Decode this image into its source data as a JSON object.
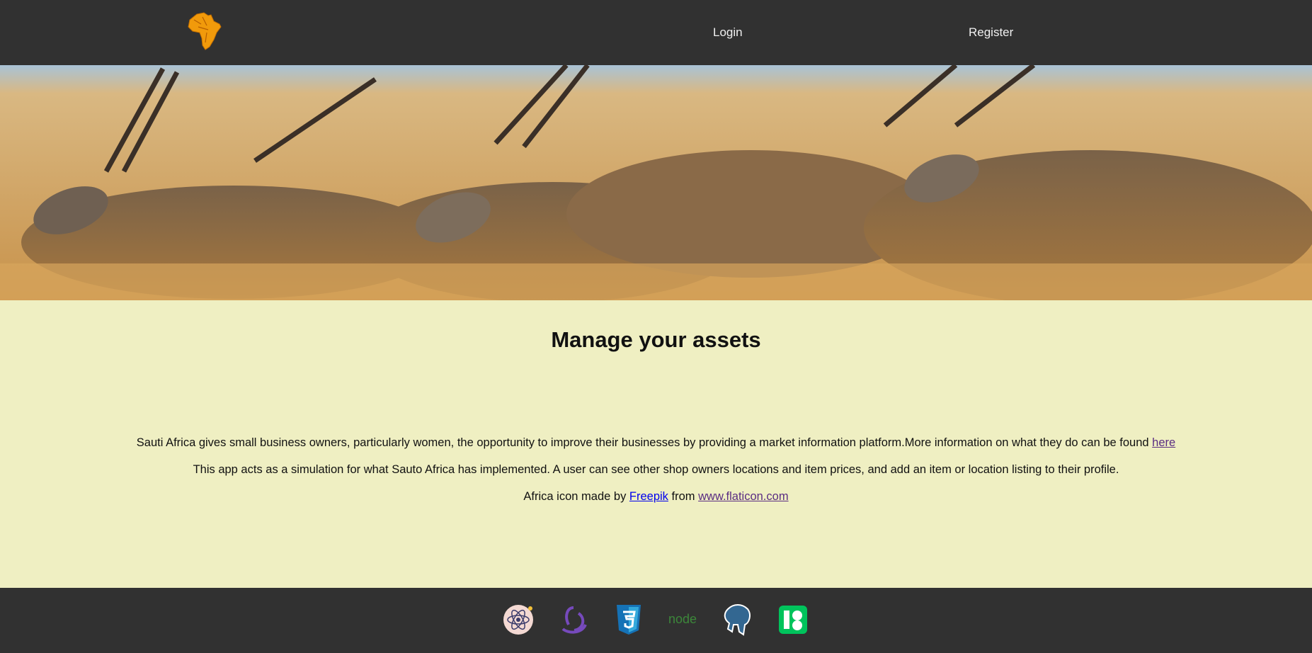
{
  "nav": {
    "login_label": "Login",
    "register_label": "Register",
    "logo_icon": "africa-icon"
  },
  "hero": {
    "image": "eland-antelopes-grassland-photo"
  },
  "main": {
    "heading": "Manage your assets",
    "intro_text": "Sauti Africa gives small business owners, particularly women, the opportunity to improve their businesses by providing a market information platform.More information on what they do can be found ",
    "intro_link": "here",
    "sim_text": "This app acts as a simulation for what Sauto Africa has implemented. A user can see other shop owners locations and item prices, and add an item or location listing to their profile.",
    "credit_prefix": "Africa icon made by ",
    "credit_author": "Freepik",
    "credit_mid": " from ",
    "credit_site": "www.flaticon.com"
  },
  "footer": {
    "icons": [
      "react-icon",
      "redux-icon",
      "css3-icon",
      "nodejs-icon",
      "postgresql-icon",
      "knex-icon"
    ],
    "node_text": "node"
  },
  "colors": {
    "nav_bg": "#313131",
    "content_bg": "#efefc2",
    "logo": "#f19a0b"
  }
}
